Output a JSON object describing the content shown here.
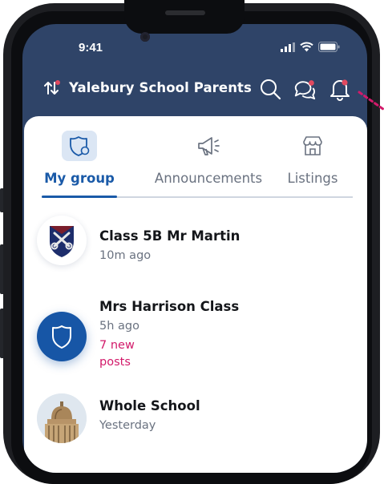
{
  "status_bar": {
    "time": "9:41"
  },
  "header": {
    "title": "Yalebury School Parents"
  },
  "tabs": [
    {
      "label": "My group",
      "icon": "shield-icon",
      "active": true
    },
    {
      "label": "Announcements",
      "icon": "megaphone-icon",
      "active": false
    },
    {
      "label": "Listings",
      "icon": "storefront-icon",
      "active": false
    }
  ],
  "groups": [
    {
      "name": "Class 5B Mr Martin",
      "time": "10m ago",
      "new_posts": "",
      "avatar": "school-crest-keys"
    },
    {
      "name": "Mrs Harrison Class",
      "time": "5h ago",
      "new_posts": "7 new posts",
      "avatar": "shield-icon"
    },
    {
      "name": "Whole School",
      "time": "Yesterday",
      "new_posts": "",
      "avatar": "building-dome"
    }
  ],
  "colors": {
    "accent": "#1a5aa8",
    "header_bg": "#2f4468",
    "alert": "#d21a6a",
    "badge": "#e2495f"
  }
}
